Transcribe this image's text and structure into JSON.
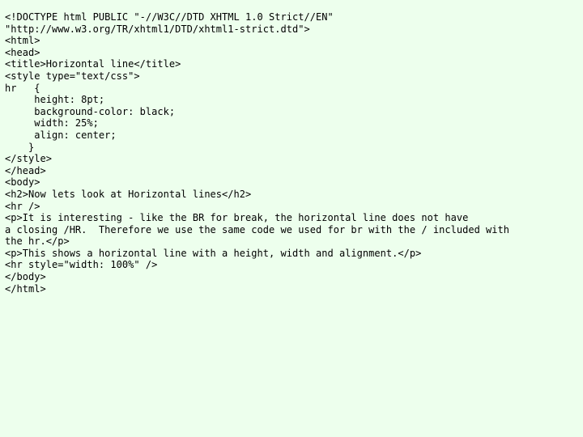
{
  "document": {
    "kind": "plain-text-source-listing",
    "language": "xhtml",
    "title": "Horizontal line",
    "background_color": "#edffed",
    "text_color": "#000000",
    "line_count": 24,
    "lines": [
      "<!DOCTYPE html PUBLIC \"-//W3C//DTD XHTML 1.0 Strict//EN\"",
      "\"http://www.w3.org/TR/xhtml1/DTD/xhtml1-strict.dtd\">",
      "<html>",
      "<head>",
      "<title>Horizontal line</title>",
      "<style type=\"text/css\">",
      "hr   {",
      "     height: 8pt;",
      "     background-color: black;",
      "     width: 25%;",
      "     align: center;",
      "    }",
      "</style>",
      "</head>",
      "<body>",
      "<h2>Now lets look at Horizontal lines</h2>",
      "<hr />",
      "<p>It is interesting - like the BR for break, the horizontal line does not have",
      "a closing /HR.  Therefore we use the same code we used for br with the / included with",
      "the hr.</p>",
      "<p>This shows a horizontal line with a height, width and alignment.</p>",
      "<hr style=\"width: 100%\" />",
      "</body>",
      "</html>"
    ]
  }
}
